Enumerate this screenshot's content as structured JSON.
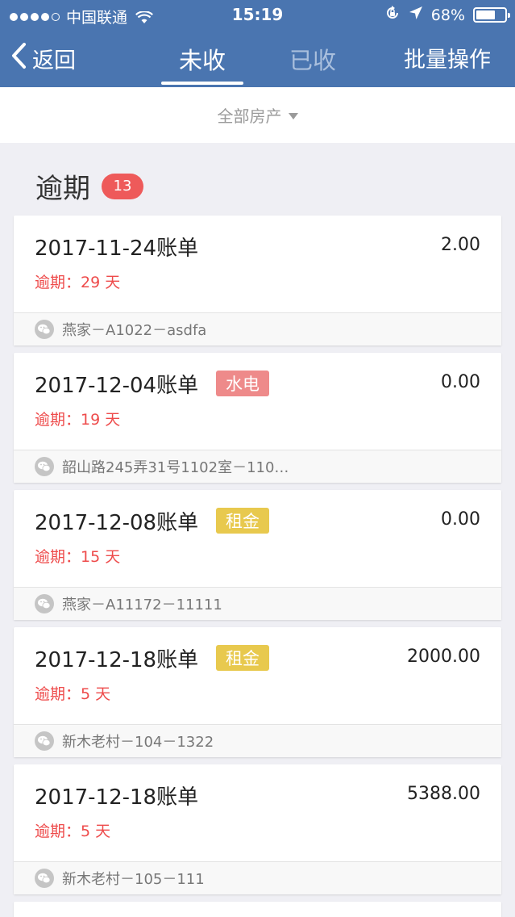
{
  "status_bar": {
    "carrier": "中国联通",
    "time": "15:19",
    "battery_percent": "68%",
    "battery_level": 0.68,
    "icons": [
      "signal-dots-icon",
      "wifi-icon",
      "orientation-lock-icon",
      "location-arrow-icon",
      "battery-icon"
    ]
  },
  "nav": {
    "back_label": "返回",
    "tabs": [
      {
        "label": "未收",
        "active": true
      },
      {
        "label": "已收",
        "active": false
      }
    ],
    "batch_label": "批量操作"
  },
  "filter": {
    "label": "全部房产"
  },
  "section": {
    "title": "逾期",
    "count": "13"
  },
  "bills": [
    {
      "title": "2017-11-24账单",
      "tag": "",
      "amount": "2.00",
      "overdue": "逾期：29 天",
      "property": "燕家－A1022－asdfa"
    },
    {
      "title": "2017-12-04账单",
      "tag": "水电",
      "tag_type": "utility",
      "amount": "0.00",
      "overdue": "逾期：19 天",
      "property": "韶山路245弄31号1102室－110…"
    },
    {
      "title": "2017-12-08账单",
      "tag": "租金",
      "tag_type": "rent",
      "amount": "0.00",
      "overdue": "逾期：15 天",
      "property": "燕家－A11172－11111"
    },
    {
      "title": "2017-12-18账单",
      "tag": "租金",
      "tag_type": "rent",
      "amount": "2000.00",
      "overdue": "逾期：5 天",
      "property": "新木老村－104－1322"
    },
    {
      "title": "2017-12-18账单",
      "tag": "",
      "amount": "5388.00",
      "overdue": "逾期：5 天",
      "property": "新木老村－105－111"
    }
  ],
  "colors": {
    "header_bg": "#4a75b0",
    "page_bg": "#efeff4",
    "overdue_red": "#ee4b4b",
    "badge_red": "#ee5a5a",
    "utility_tag": "#ee8a8a",
    "rent_tag": "#e8c94e"
  }
}
